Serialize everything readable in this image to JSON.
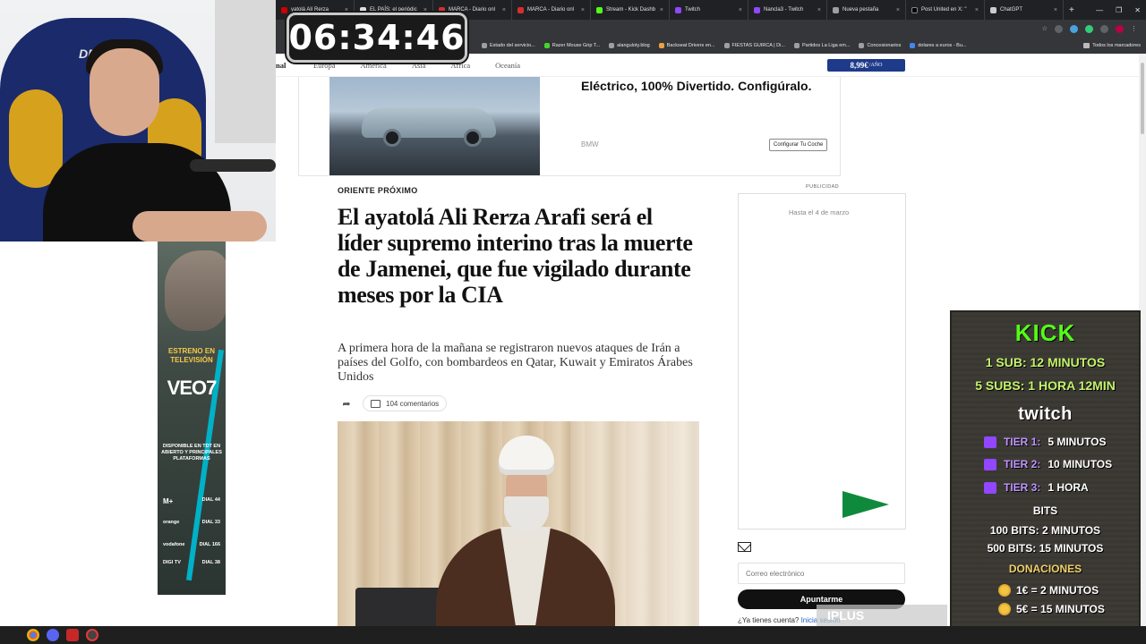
{
  "browser": {
    "tabs": [
      {
        "label": "yatolá Alí Rerza"
      },
      {
        "label": "EL PAÍS: el periódic"
      },
      {
        "label": "MARCA - Diario onl"
      },
      {
        "label": "MARCA - Diario onl"
      },
      {
        "label": "Stream - Kick Dashb"
      },
      {
        "label": "Twitch"
      },
      {
        "label": "Nancla3 - Twitch"
      },
      {
        "label": "Nueva pestaña"
      },
      {
        "label": "Post United en X: \""
      },
      {
        "label": "ChatGPT"
      }
    ],
    "bookmarks": [
      {
        "label": "Estado del servicio..."
      },
      {
        "label": "Razer Mouse Grip T..."
      },
      {
        "label": "alanguloty.blog"
      },
      {
        "label": "Backseat Drivers en..."
      },
      {
        "label": "FIESTAS GUIRCA | Di..."
      },
      {
        "label": "Partidos La Liga em..."
      },
      {
        "label": "Concesionarios"
      },
      {
        "label": "dolares a euros - Bu..."
      }
    ],
    "all_bookmarks": "Todos los marcadores"
  },
  "site": {
    "nav_cut": "nal",
    "regions": [
      "Europa",
      "América",
      "Asia",
      "África",
      "Oceanía"
    ],
    "subscribe_price": "8,99€",
    "subscribe_period": "/AÑO"
  },
  "ad_top": {
    "headline": "Eléctrico, 100% Divertido. Configúralo.",
    "brand": "BMW",
    "cta": "Configurar Tu Coche"
  },
  "article": {
    "kicker": "ORIENTE PRÓXIMO",
    "headline": "El ayatolá Ali Rerza Arafi será el líder supremo interino tras la muerte de Jamenei, que fue vigilado durante meses por la CIA",
    "standfirst": "A primera hora de la mañana se registraron nuevos ataques de Irán a países del Golfo, con bombardeos en Qatar, Kuwait y Emiratos Árabes Unidos",
    "comments": "104 comentarios"
  },
  "sidebar": {
    "pub_label": "PUBLICIDAD",
    "promo_until": "Hasta el 4 de marzo",
    "newsletter_placeholder": "Correo electrónico",
    "signup": "Apuntarme",
    "account_q": "¿Ya tienes cuenta?",
    "login": "Inicia sesión"
  },
  "stream": {
    "timer": "06:34:46",
    "chair_brand": "DRIFT",
    "left_ad": {
      "estreno": "ESTRENO EN TELEVISIÓN",
      "brand": "VEO7",
      "disponible": "DISPONIBLE EN TDT EN ABIERTO Y PRINCIPALES PLATAFORMAS",
      "dials": [
        {
          "name": "M+",
          "dial": "DIAL 44"
        },
        {
          "name": "orange",
          "dial": "DIAL 33"
        },
        {
          "name": "vodafone",
          "dial": "DIAL 166"
        },
        {
          "name": "DIGI TV",
          "dial": "DIAL 38"
        }
      ]
    },
    "panel": {
      "kick": "KICK",
      "kick_1": "1 SUB: 12 MINUTOS",
      "kick_5": "5 SUBS: 1 HORA 12MIN",
      "twitch": "twitch",
      "tier1_label": "TIER 1:",
      "tier1_value": "5 MINUTOS",
      "tier2_label": "TIER 2:",
      "tier2_value": "10 MINUTOS",
      "tier3_label": "TIER 3:",
      "tier3_value": "1 HORA",
      "bits": "BITS",
      "bits_100": "100 BITS: 2 MINUTOS",
      "bits_500": "500 BITS: 15 MINUTOS",
      "donations": "DONACIONES",
      "don_1": "1€ = 2 MINUTOS",
      "don_5": "5€ = 15 MINUTOS"
    },
    "iplus": "IPLUS"
  },
  "colors": {
    "kick_green": "#53fc18",
    "twitch_purple": "#9146ff",
    "subscribe_blue": "#1e3a8a"
  }
}
